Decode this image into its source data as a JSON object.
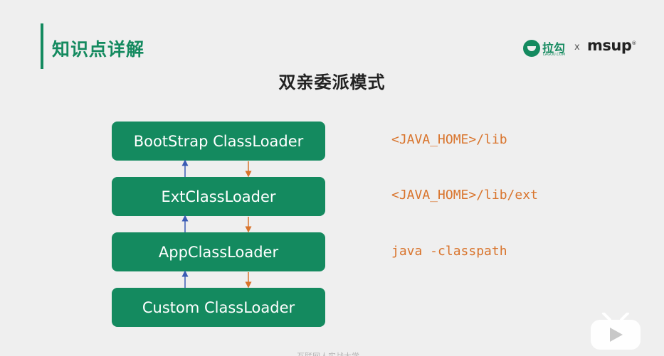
{
  "header": {
    "section_title": "知识点详解",
    "brand": {
      "lagou_name": "拉勾",
      "lagou_sub": "LAGOU.COM",
      "separator": "x",
      "msup": "msup",
      "msup_mark": "®"
    }
  },
  "slide_title": "双亲委派模式",
  "loaders": [
    {
      "label": "BootStrap ClassLoader",
      "path": "<JAVA_HOME>/lib"
    },
    {
      "label": "ExtClassLoader",
      "path": "<JAVA_HOME>/lib/ext"
    },
    {
      "label": "AppClassLoader",
      "path": "java -classpath"
    },
    {
      "label": "Custom ClassLoader",
      "path": ""
    }
  ],
  "colors": {
    "brand_green": "#148a5f",
    "path_orange": "#d9742c",
    "delegate_up_arrow": "#3b5bb5",
    "load_down_arrow": "#d9742c"
  },
  "footer": {
    "watermark": "互联网人实战大学"
  },
  "overlay": {
    "icon": "bilibili-play-icon"
  }
}
